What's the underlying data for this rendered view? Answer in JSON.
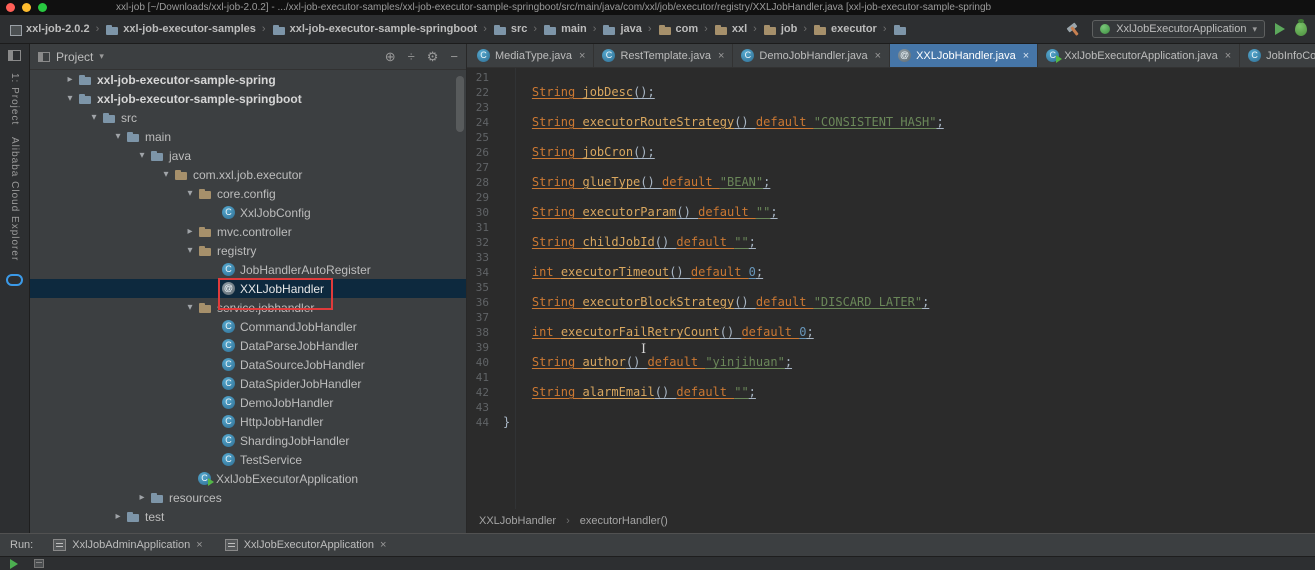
{
  "title_bar": {
    "title": "xxl-job [~/Downloads/xxl-job-2.0.2] - .../xxl-job-executor-samples/xxl-job-executor-sample-springboot/src/main/java/com/xxl/job/executor/registry/XXLJobHandler.java [xxl-job-executor-sample-springb"
  },
  "navbar": {
    "breadcrumbs": [
      {
        "label": "xxl-job-2.0.2",
        "icon": "project"
      },
      {
        "label": "xxl-job-executor-samples",
        "icon": "folder"
      },
      {
        "label": "xxl-job-executor-sample-springboot",
        "icon": "folder"
      },
      {
        "label": "src",
        "icon": "folder"
      },
      {
        "label": "main",
        "icon": "folder"
      },
      {
        "label": "java",
        "icon": "folder"
      },
      {
        "label": "com",
        "icon": "pkg"
      },
      {
        "label": "xxl",
        "icon": "pkg"
      },
      {
        "label": "job",
        "icon": "pkg"
      },
      {
        "label": "executor",
        "icon": "pkg"
      },
      {
        "label": "",
        "icon": "folder"
      }
    ],
    "run_config": "XxlJobExecutorApplication"
  },
  "stripe": {
    "project_label": "1: Project",
    "cloud_label": "Alibaba Cloud Explorer"
  },
  "project_panel": {
    "header_title": "Project",
    "tree": [
      {
        "l": "xxl-job-executor-sample-spring",
        "lv": 1,
        "a": "r",
        "i": "folder",
        "b": true
      },
      {
        "l": "xxl-job-executor-sample-springboot",
        "lv": 1,
        "a": "d",
        "i": "folder",
        "b": true
      },
      {
        "l": "src",
        "lv": 2,
        "a": "d",
        "i": "folder"
      },
      {
        "l": "main",
        "lv": 3,
        "a": "d",
        "i": "folder"
      },
      {
        "l": "java",
        "lv": 4,
        "a": "d",
        "i": "folder"
      },
      {
        "l": "com.xxl.job.executor",
        "lv": 5,
        "a": "d",
        "i": "pkg"
      },
      {
        "l": "core.config",
        "lv": 6,
        "a": "d",
        "i": "pkg"
      },
      {
        "l": "XxlJobConfig",
        "lv": 7,
        "i": "cls"
      },
      {
        "l": "mvc.controller",
        "lv": 6,
        "a": "r",
        "i": "pkg"
      },
      {
        "l": "registry",
        "lv": 6,
        "a": "d",
        "i": "pkg"
      },
      {
        "l": "JobHandlerAutoRegister",
        "lv": 7,
        "i": "cls"
      },
      {
        "l": "XXLJobHandler",
        "lv": 7,
        "i": "ann",
        "sel": true,
        "red": true
      },
      {
        "l": "service.jobhandler",
        "lv": 6,
        "a": "d",
        "i": "pkg"
      },
      {
        "l": "CommandJobHandler",
        "lv": 7,
        "i": "cls"
      },
      {
        "l": "DataParseJobHandler",
        "lv": 7,
        "i": "cls"
      },
      {
        "l": "DataSourceJobHandler",
        "lv": 7,
        "i": "cls"
      },
      {
        "l": "DataSpiderJobHandler",
        "lv": 7,
        "i": "cls"
      },
      {
        "l": "DemoJobHandler",
        "lv": 7,
        "i": "cls"
      },
      {
        "l": "HttpJobHandler",
        "lv": 7,
        "i": "cls"
      },
      {
        "l": "ShardingJobHandler",
        "lv": 7,
        "i": "cls"
      },
      {
        "l": "TestService",
        "lv": 7,
        "i": "cls"
      },
      {
        "l": "XxlJobExecutorApplication",
        "lv": 6,
        "i": "run"
      },
      {
        "l": "resources",
        "lv": 4,
        "a": "r",
        "i": "folder"
      },
      {
        "l": "test",
        "lv": 3,
        "a": "r",
        "i": "folder"
      }
    ]
  },
  "editor": {
    "tabs": [
      {
        "label": "MediaType.java",
        "icon": "cls"
      },
      {
        "label": "RestTemplate.java",
        "icon": "cls"
      },
      {
        "label": "DemoJobHandler.java",
        "icon": "cls"
      },
      {
        "label": "XXLJobHandler.java",
        "icon": "ann",
        "active": true
      },
      {
        "label": "XxlJobExecutorApplication.java",
        "icon": "run"
      },
      {
        "label": "JobInfoCo",
        "icon": "cls"
      }
    ],
    "lines": [
      {
        "n": "21",
        "s": []
      },
      {
        "n": "22",
        "s": [
          [
            "sp",
            "    "
          ],
          [
            "k",
            "String "
          ],
          [
            "f",
            "jobDesc"
          ],
          [
            "p",
            "();"
          ]
        ]
      },
      {
        "n": "23",
        "s": []
      },
      {
        "n": "24",
        "s": [
          [
            "sp",
            "    "
          ],
          [
            "k",
            "String "
          ],
          [
            "f",
            "executorRouteStrategy"
          ],
          [
            "p",
            "() "
          ],
          [
            "k",
            "default "
          ],
          [
            "str",
            "\"CONSISTENT_HASH\""
          ],
          [
            "p",
            ";"
          ]
        ]
      },
      {
        "n": "25",
        "s": []
      },
      {
        "n": "26",
        "s": [
          [
            "sp",
            "    "
          ],
          [
            "k",
            "String "
          ],
          [
            "f",
            "jobCron"
          ],
          [
            "p",
            "();"
          ]
        ]
      },
      {
        "n": "27",
        "s": []
      },
      {
        "n": "28",
        "s": [
          [
            "sp",
            "    "
          ],
          [
            "k",
            "String "
          ],
          [
            "f",
            "glueType"
          ],
          [
            "p",
            "() "
          ],
          [
            "k",
            "default "
          ],
          [
            "str",
            "\"BEAN\""
          ],
          [
            "p",
            ";"
          ]
        ]
      },
      {
        "n": "29",
        "s": []
      },
      {
        "n": "30",
        "s": [
          [
            "sp",
            "    "
          ],
          [
            "k",
            "String "
          ],
          [
            "f",
            "executorParam"
          ],
          [
            "p",
            "() "
          ],
          [
            "k",
            "default "
          ],
          [
            "str",
            "\"\""
          ],
          [
            "p",
            ";"
          ]
        ]
      },
      {
        "n": "31",
        "s": []
      },
      {
        "n": "32",
        "s": [
          [
            "sp",
            "    "
          ],
          [
            "k",
            "String "
          ],
          [
            "f",
            "childJobId"
          ],
          [
            "p",
            "() "
          ],
          [
            "k",
            "default "
          ],
          [
            "str",
            "\"\""
          ],
          [
            "p",
            ";"
          ]
        ]
      },
      {
        "n": "33",
        "s": []
      },
      {
        "n": "34",
        "s": [
          [
            "sp",
            "    "
          ],
          [
            "k",
            "int "
          ],
          [
            "f",
            "executorTimeout"
          ],
          [
            "p",
            "() "
          ],
          [
            "k",
            "default "
          ],
          [
            "num",
            "0"
          ],
          [
            "p",
            ";"
          ]
        ]
      },
      {
        "n": "35",
        "s": []
      },
      {
        "n": "36",
        "s": [
          [
            "sp",
            "    "
          ],
          [
            "k",
            "String "
          ],
          [
            "f",
            "executorBlockStrategy"
          ],
          [
            "p",
            "() "
          ],
          [
            "k",
            "default "
          ],
          [
            "str",
            "\"DISCARD_LATER\""
          ],
          [
            "p",
            ";"
          ]
        ]
      },
      {
        "n": "37",
        "s": []
      },
      {
        "n": "38",
        "s": [
          [
            "sp",
            "    "
          ],
          [
            "k",
            "int "
          ],
          [
            "f",
            "executorFailRetryCount"
          ],
          [
            "p",
            "() "
          ],
          [
            "k",
            "default "
          ],
          [
            "num",
            "0"
          ],
          [
            "p",
            ";"
          ]
        ]
      },
      {
        "n": "39",
        "s": []
      },
      {
        "n": "40",
        "s": [
          [
            "sp",
            "    "
          ],
          [
            "k",
            "String "
          ],
          [
            "f",
            "author"
          ],
          [
            "p",
            "() "
          ],
          [
            "k",
            "default "
          ],
          [
            "str",
            "\"yinjihuan\""
          ],
          [
            "p",
            ";"
          ]
        ]
      },
      {
        "n": "41",
        "s": []
      },
      {
        "n": "42",
        "s": [
          [
            "sp",
            "    "
          ],
          [
            "k",
            "String "
          ],
          [
            "f",
            "alarmEmail"
          ],
          [
            "p",
            "() "
          ],
          [
            "k",
            "default "
          ],
          [
            "str",
            "\"\""
          ],
          [
            "p",
            ";"
          ]
        ]
      },
      {
        "n": "43",
        "s": []
      },
      {
        "n": "44",
        "s": [
          [
            "pl",
            "}"
          ]
        ]
      }
    ],
    "breadcrumb": [
      "XXLJobHandler",
      "executorHandler()"
    ]
  },
  "run_panel": {
    "label": "Run:",
    "tabs": [
      {
        "label": "XxlJobAdminApplication"
      },
      {
        "label": "XxlJobExecutorApplication"
      }
    ]
  },
  "colors": {
    "active_tab": "#4676A8",
    "tree_selection": "#0D293E",
    "highlight_box_red": "#E03B3B",
    "run_green": "#5CA85C",
    "keyword_orange": "#CC7832",
    "string_green": "#6A8759",
    "number_blue": "#6897BB"
  }
}
